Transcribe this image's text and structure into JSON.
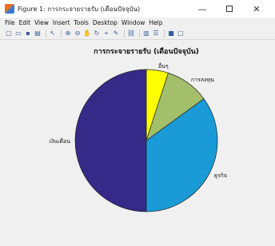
{
  "window": {
    "title": "Figure 1: การกระจายรายรับ (เดือนปัจจุบัน)",
    "minimize_glyph": "—",
    "close_glyph": "✕"
  },
  "menu": [
    "File",
    "Edit",
    "View",
    "Insert",
    "Tools",
    "Desktop",
    "Window",
    "Help"
  ],
  "toolbar": {
    "icons": [
      "new-figure-icon",
      "open-file-icon",
      "save-icon",
      "print-icon",
      "sep",
      "pointer-icon",
      "sep",
      "zoom-in-icon",
      "zoom-out-icon",
      "pan-icon",
      "rotate-icon",
      "data-cursor-icon",
      "brush-icon",
      "sep",
      "link-icon",
      "sep",
      "colorbar-icon",
      "legend-icon",
      "sep",
      "hide-plot-tools-icon",
      "show-plot-tools-icon"
    ],
    "glyphs": {
      "new-figure-icon": "▢",
      "open-file-icon": "▭",
      "save-icon": "▪",
      "print-icon": "▤",
      "pointer-icon": "↖",
      "zoom-in-icon": "⊕",
      "zoom-out-icon": "⊖",
      "pan-icon": "✋",
      "rotate-icon": "↻",
      "data-cursor-icon": "⌖",
      "brush-icon": "✎",
      "link-icon": "⛓",
      "colorbar-icon": "▥",
      "legend-icon": "☰",
      "hide-plot-tools-icon": "■",
      "show-plot-tools-icon": "□"
    }
  },
  "chart_data": {
    "type": "pie",
    "title": "การกระจายรายรับ (เดือนปัจจุบัน)",
    "labels": [
      "อื่นๆ",
      "การลงทุน",
      "ธุรกิจ",
      "เงินเดือน"
    ],
    "values": [
      5,
      10,
      35,
      50
    ],
    "colors": [
      "#ffff00",
      "#a3bf6a",
      "#1a9bd7",
      "#352a87"
    ],
    "start_angle_deg": 90,
    "direction": "clockwise"
  }
}
